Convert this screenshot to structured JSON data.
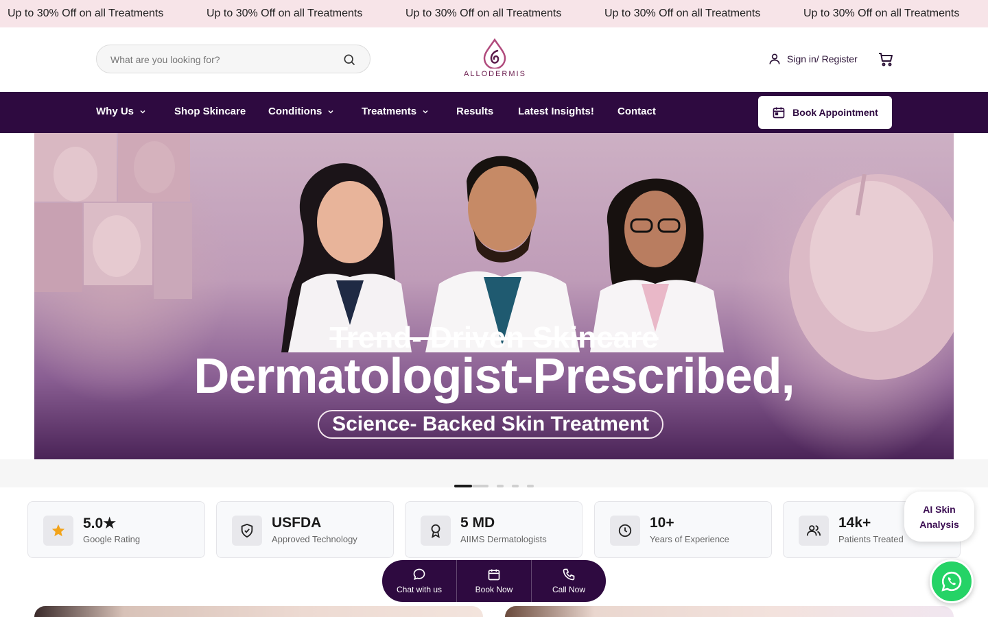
{
  "promo": {
    "items": [
      "Up to 30% Off on all Treatments",
      "Up to 30% Off on all Treatments",
      "Up to 30% Off on all Treatments",
      "Up to 30% Off on all Treatments",
      "Up to 30% Off on all Treatments"
    ]
  },
  "header": {
    "search_placeholder": "What are you looking for?",
    "brand": "ALLODERMIS",
    "signin_label": "Sign in/ Register"
  },
  "nav": {
    "items": [
      {
        "label": "Why Us",
        "dropdown": true
      },
      {
        "label": "Shop Skincare",
        "dropdown": false
      },
      {
        "label": "Conditions",
        "dropdown": true
      },
      {
        "label": "Treatments",
        "dropdown": true
      },
      {
        "label": "Results",
        "dropdown": false
      },
      {
        "label": "Latest Insights!",
        "dropdown": false
      },
      {
        "label": "Contact",
        "dropdown": false
      }
    ],
    "book_label": "Book Appointment"
  },
  "hero": {
    "strike_text": "Trend- Driven Skincare",
    "title": "Dermatologist-Prescribed,",
    "pill": "Science- Backed Skin Treatment",
    "slides_total": 5,
    "active_slide": 1
  },
  "stats": [
    {
      "value": "5.0★",
      "label": "Google Rating",
      "icon": "star-icon"
    },
    {
      "value": "USFDA",
      "label": "Approved Technology",
      "icon": "shield-check-icon"
    },
    {
      "value": "5 MD",
      "label": "AIIMS Dermatologists",
      "icon": "award-icon"
    },
    {
      "value": "10+",
      "label": "Years of Experience",
      "icon": "clock-icon"
    },
    {
      "value": "14k+",
      "label": "Patients Treated",
      "icon": "users-icon"
    }
  ],
  "ai_skin": {
    "line1": "AI Skin",
    "line2": "Analysis"
  },
  "actions": [
    {
      "label": "Chat with us",
      "icon": "chat-icon"
    },
    {
      "label": "Book Now",
      "icon": "calendar-icon"
    },
    {
      "label": "Call Now",
      "icon": "phone-icon"
    }
  ],
  "colors": {
    "brand_dark": "#2e0a40",
    "promo_bg": "#f7e4e8",
    "accent_star": "#f2a31a",
    "whatsapp": "#25d366"
  }
}
